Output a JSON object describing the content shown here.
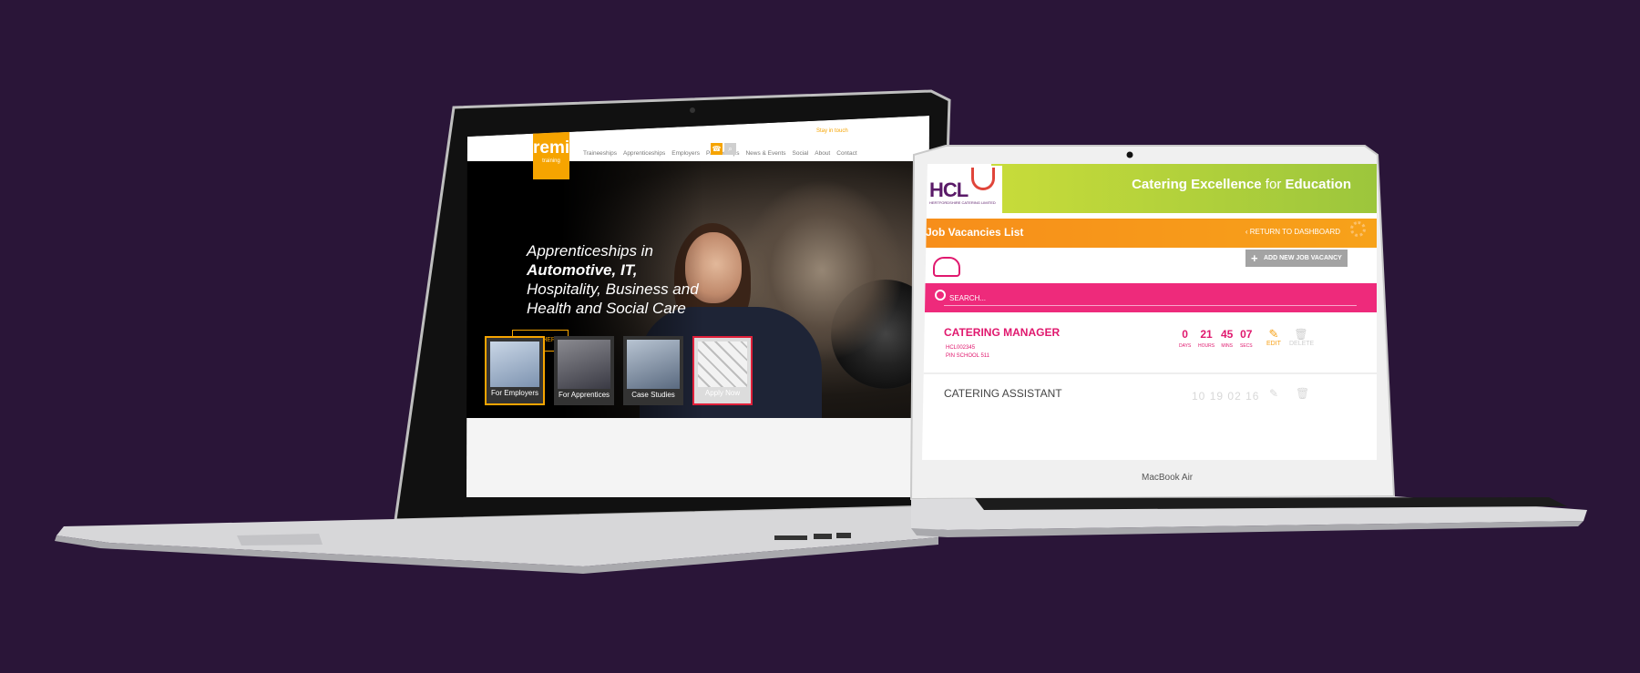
{
  "left_site": {
    "logo": {
      "name": "remit",
      "sub": "training"
    },
    "touch": "Stay in touch",
    "menu": [
      "Traineeships",
      "Apprenticeships",
      "Employers",
      "Partnerships",
      "News & Events",
      "Social",
      "About",
      "Contact"
    ],
    "hero": {
      "line1": "Apprenticeships in",
      "line2": "Automotive, IT,",
      "line3": "Hospitality, Business and",
      "line4": "Health and Social Care"
    },
    "apply_button": "APPLY HERE",
    "tiles": [
      "For Employers",
      "For Apprentices",
      "Case Studies",
      "Apply Now"
    ],
    "colors": {
      "accent": "#f6a400",
      "apply_now_border": "#e0203a"
    }
  },
  "right_app": {
    "logo": {
      "initials": "HCL",
      "sub": "HERTFORDSHIRE CATERING LIMITED"
    },
    "tagline": {
      "part1": "Catering Excellence",
      "part2": " for ",
      "part3": "Education"
    },
    "section_title": "Job Vacancies List",
    "return_link": "RETURN TO DASHBOARD",
    "add_button": "ADD NEW JOB VACANCY",
    "search": {
      "placeholder": "SEARCH..."
    },
    "jobs": [
      {
        "title": "CATERING MANAGER",
        "ref": "HCL002345",
        "school": "PIN SCHOOL 511",
        "countdown": [
          {
            "value": "0",
            "unit": "DAYS"
          },
          {
            "value": "21",
            "unit": "HOURS"
          },
          {
            "value": "45",
            "unit": "MINS"
          },
          {
            "value": "07",
            "unit": "SECS"
          }
        ],
        "edit_label": "EDIT",
        "delete_label": "DELETE"
      },
      {
        "title": "CATERING ASSISTANT",
        "countdown": [
          "10",
          "19",
          "02",
          "16"
        ]
      }
    ],
    "colors": {
      "green": "#9cc63c",
      "orange": "#f78e1a",
      "pink": "#ee2a7b",
      "text_pink": "#e0186e"
    }
  },
  "devices": {
    "right_model": "MacBook Air"
  }
}
